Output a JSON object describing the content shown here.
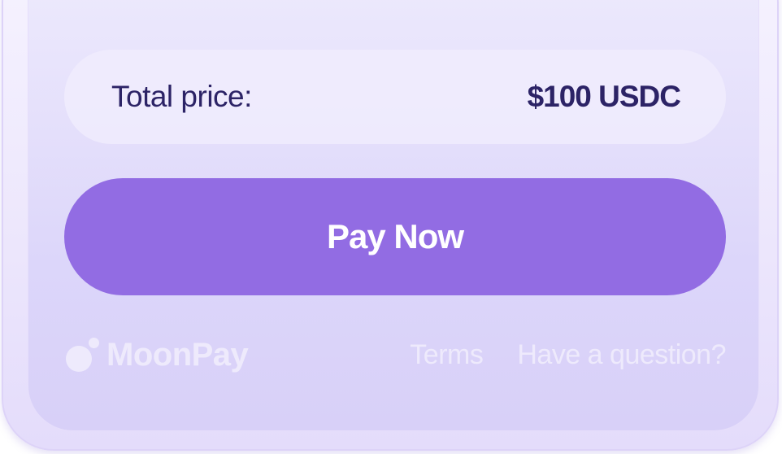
{
  "summary": {
    "total_label": "Total price:",
    "total_value": "$100 USDC"
  },
  "actions": {
    "pay_label": "Pay Now"
  },
  "footer": {
    "brand_name": "MoonPay",
    "brand_icon": "moonpay-logo-icon",
    "terms_label": "Terms",
    "help_label": "Have a question?"
  },
  "colors": {
    "accent": "#926ce3",
    "text_dark": "#2c2366",
    "footer_text": "#eeeafc"
  }
}
